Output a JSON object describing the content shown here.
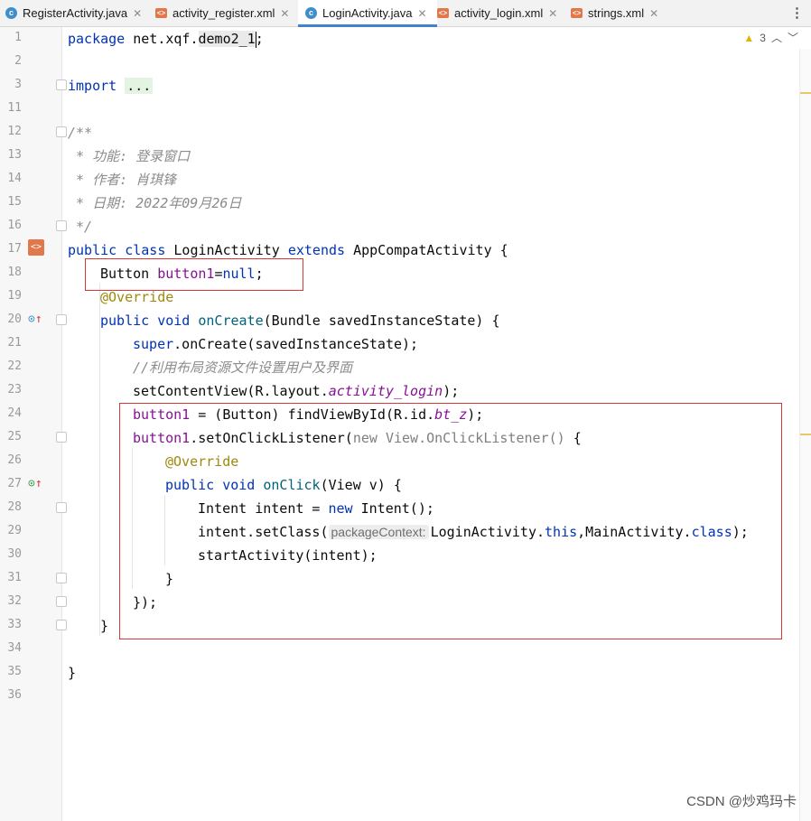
{
  "tabs": [
    {
      "label": "RegisterActivity.java",
      "icon": "class-icon"
    },
    {
      "label": "activity_register.xml",
      "icon": "xml-icon"
    },
    {
      "label": "LoginActivity.java",
      "icon": "class-icon",
      "active": true
    },
    {
      "label": "activity_login.xml",
      "icon": "xml-icon"
    },
    {
      "label": "strings.xml",
      "icon": "xml-icon"
    }
  ],
  "inspection": {
    "warnings": "3"
  },
  "line_numbers": [
    "1",
    "2",
    "3",
    "11",
    "12",
    "13",
    "14",
    "15",
    "16",
    "17",
    "18",
    "19",
    "20",
    "21",
    "22",
    "23",
    "24",
    "25",
    "26",
    "27",
    "28",
    "29",
    "30",
    "31",
    "32",
    "33",
    "34",
    "35",
    "36"
  ],
  "code": {
    "l1_kw": "package",
    "l1_rest": " net.xqf.",
    "l1_pkg": "demo2_1",
    "l1_end": ";",
    "l3_kw": "import",
    "l3_dots": "...",
    "l12": "/**",
    "l13": " * 功能: 登录窗口",
    "l14": " * 作者: 肖琪锋",
    "l15": " * 日期: 2022年09月26日",
    "l16": " */",
    "l17_kw": "public class",
    "l17_name": " LoginActivity ",
    "l17_ext": "extends",
    "l17_rest": " AppCompatActivity {",
    "l18_type": "Button ",
    "l18_field": "button1",
    "l18_eq": "=",
    "l18_null": "null",
    "l18_end": ";",
    "l19": "@Override",
    "l20_kw": "public void ",
    "l20_fn": "onCreate",
    "l20_rest": "(Bundle savedInstanceState) {",
    "l21_kw": "super",
    "l21_rest": ".onCreate(savedInstanceState);",
    "l22": "//利用布局资源文件设置用户及界面",
    "l23_a": "setContentView(R.layout.",
    "l23_b": "activity_login",
    "l23_c": ");",
    "l24_a": "button1",
    "l24_b": " = (Button) findViewById(R.id.",
    "l24_c": "bt_z",
    "l24_d": ");",
    "l25_a": "button1",
    "l25_b": ".setOnClickListener(",
    "l25_c": "new View.OnClickListener() ",
    "l25_d": "{",
    "l26": "@Override",
    "l27_kw": "public void ",
    "l27_fn": "onClick",
    "l27_rest": "(View v) {",
    "l28_a": "Intent intent = ",
    "l28_kw": "new",
    "l28_b": " Intent();",
    "l29_a": "intent.setClass(",
    "l29_hint": "packageContext:",
    "l29_b": "LoginActivity.",
    "l29_this": "this",
    "l29_c": ",MainActivity.",
    "l29_cls": "class",
    "l29_d": ");",
    "l30": "startActivity(intent);",
    "l31": "}",
    "l32": "});",
    "l33": "}",
    "l35": "}"
  },
  "watermark": "CSDN @炒鸡玛卡"
}
